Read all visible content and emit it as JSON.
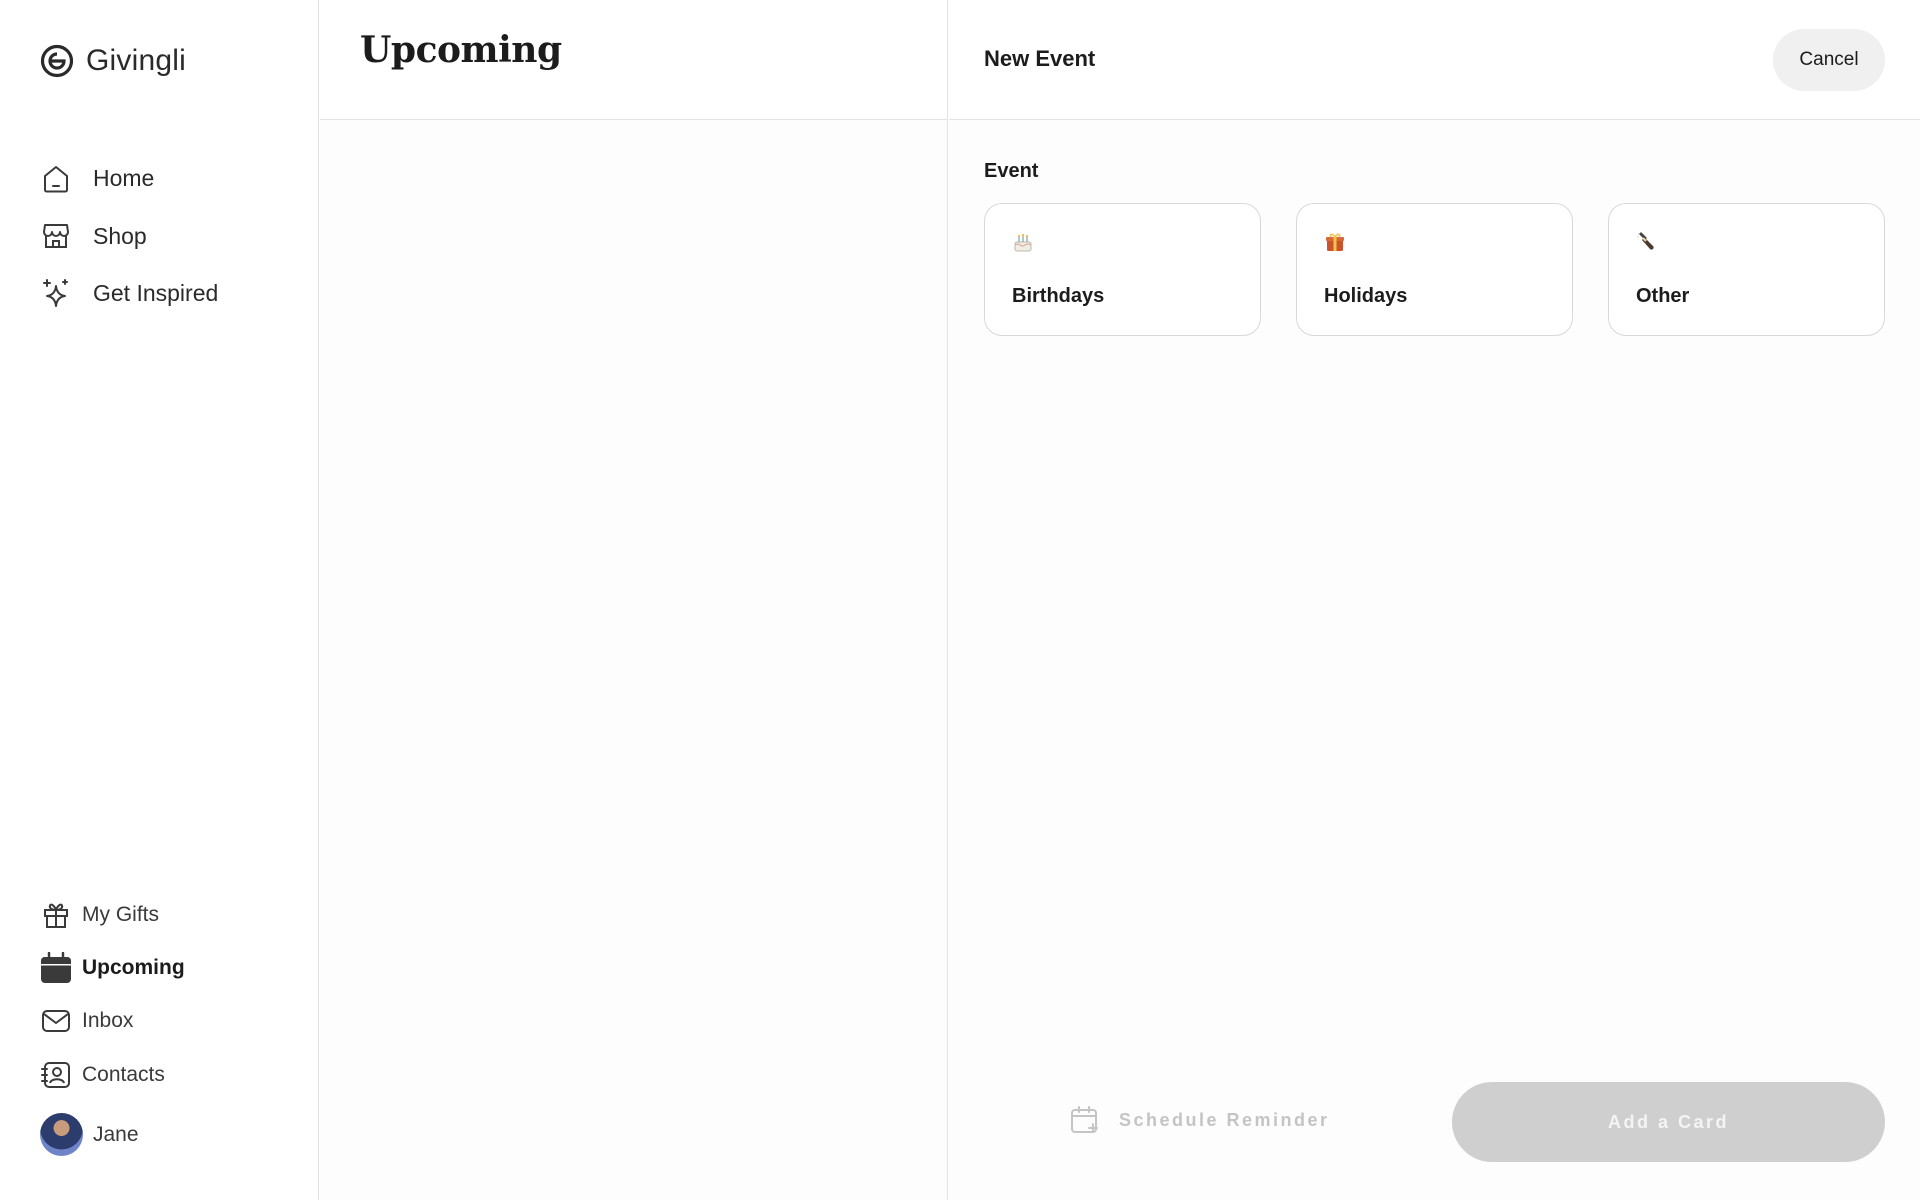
{
  "app": {
    "name": "Givingli"
  },
  "sidebar": {
    "top_items": [
      {
        "label": "Home",
        "icon": "home-icon"
      },
      {
        "label": "Shop",
        "icon": "shop-icon"
      },
      {
        "label": "Get Inspired",
        "icon": "sparkles-icon"
      }
    ],
    "bottom_items": [
      {
        "label": "My Gifts",
        "icon": "gift-icon"
      },
      {
        "label": "Upcoming",
        "icon": "calendar-icon",
        "active": true
      },
      {
        "label": "Inbox",
        "icon": "mail-icon"
      },
      {
        "label": "Contacts",
        "icon": "contacts-icon"
      }
    ],
    "user": {
      "name": "Jane"
    }
  },
  "middle": {
    "title": "Upcoming"
  },
  "panel": {
    "title": "New Event",
    "cancel_label": "Cancel",
    "section_label": "Event",
    "event_types": [
      {
        "label": "Birthdays",
        "icon": "birthday-cake-icon"
      },
      {
        "label": "Holidays",
        "icon": "gift-box-icon"
      },
      {
        "label": "Other",
        "icon": "champagne-icon"
      }
    ],
    "schedule_reminder_label": "Schedule Reminder",
    "add_card_label": "Add a Card"
  },
  "colors": {
    "accent_disabled": "#cfcfcf",
    "text_primary": "#1c1c1c",
    "border": "#e3e3e3"
  }
}
